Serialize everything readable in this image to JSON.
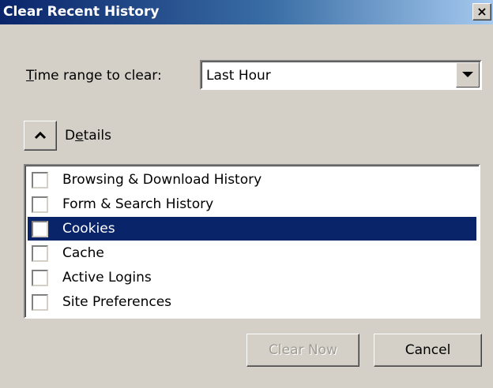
{
  "window": {
    "title": "Clear Recent History",
    "close_glyph": "×"
  },
  "time_range": {
    "label_prefix": "",
    "label_mnemonic": "T",
    "label_rest": "ime range to clear:",
    "selected": "Last Hour"
  },
  "details": {
    "label_prefix": "D",
    "label_mnemonic": "e",
    "label_rest": "tails",
    "expanded": true
  },
  "items": [
    {
      "label": "Browsing & Download History",
      "checked": false,
      "selected": false
    },
    {
      "label": "Form & Search History",
      "checked": false,
      "selected": false
    },
    {
      "label": "Cookies",
      "checked": false,
      "selected": true
    },
    {
      "label": "Cache",
      "checked": false,
      "selected": false
    },
    {
      "label": "Active Logins",
      "checked": false,
      "selected": false
    },
    {
      "label": "Site Preferences",
      "checked": false,
      "selected": false
    }
  ],
  "buttons": {
    "clear_now": "Clear Now",
    "cancel": "Cancel"
  },
  "colors": {
    "title_bar": "#0a246a",
    "selection": "#0a246a",
    "face": "#d4d0c8"
  },
  "icons": {
    "close": "close-icon",
    "dropdown": "triangle-down-icon",
    "details": "chevron-up-icon"
  }
}
